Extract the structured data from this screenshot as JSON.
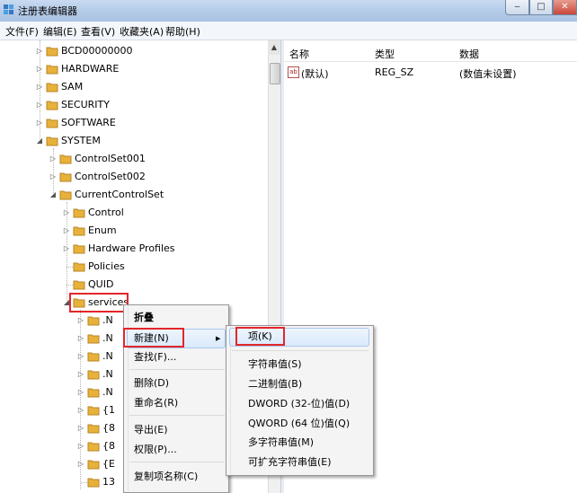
{
  "window": {
    "title": "注册表编辑器",
    "minimize": "‒",
    "maximize": "□",
    "close": "✕"
  },
  "menubar": [
    "文件(F)",
    "编辑(E)",
    "查看(V)",
    "收藏夹(A)",
    "帮助(H)"
  ],
  "tree": {
    "roots": [
      "BCD00000000",
      "HARDWARE",
      "SAM",
      "SECURITY",
      "SOFTWARE",
      "SYSTEM"
    ],
    "system_children": [
      "ControlSet001",
      "ControlSet002",
      "CurrentControlSet"
    ],
    "ccs_children": [
      "Control",
      "Enum",
      "Hardware Profiles",
      "Policies",
      "QUID",
      "services"
    ],
    "services_children": [
      ".N",
      ".N",
      ".N",
      ".N",
      ".N",
      "{1",
      "{8",
      "{8",
      "{E",
      "13"
    ]
  },
  "values": {
    "headers": [
      "名称",
      "类型",
      "数据"
    ],
    "rows": [
      {
        "name": "(默认)",
        "type": "REG_SZ",
        "data": "(数值未设置)",
        "icon": "string-value-icon"
      }
    ]
  },
  "context_menu": {
    "items": [
      "折叠",
      "新建(N)",
      "查找(F)...",
      "删除(D)",
      "重命名(R)",
      "导出(E)",
      "权限(P)...",
      "复制项名称(C)"
    ],
    "submenu_arrow": "▶"
  },
  "new_submenu": {
    "items": [
      "项(K)",
      "字符串值(S)",
      "二进制值(B)",
      "DWORD (32-位)值(D)",
      "QWORD (64 位)值(Q)",
      "多字符串值(M)",
      "可扩充字符串值(E)"
    ]
  },
  "colors": {
    "highlight_box": "#e3262b",
    "folder": "#e8b23a"
  }
}
